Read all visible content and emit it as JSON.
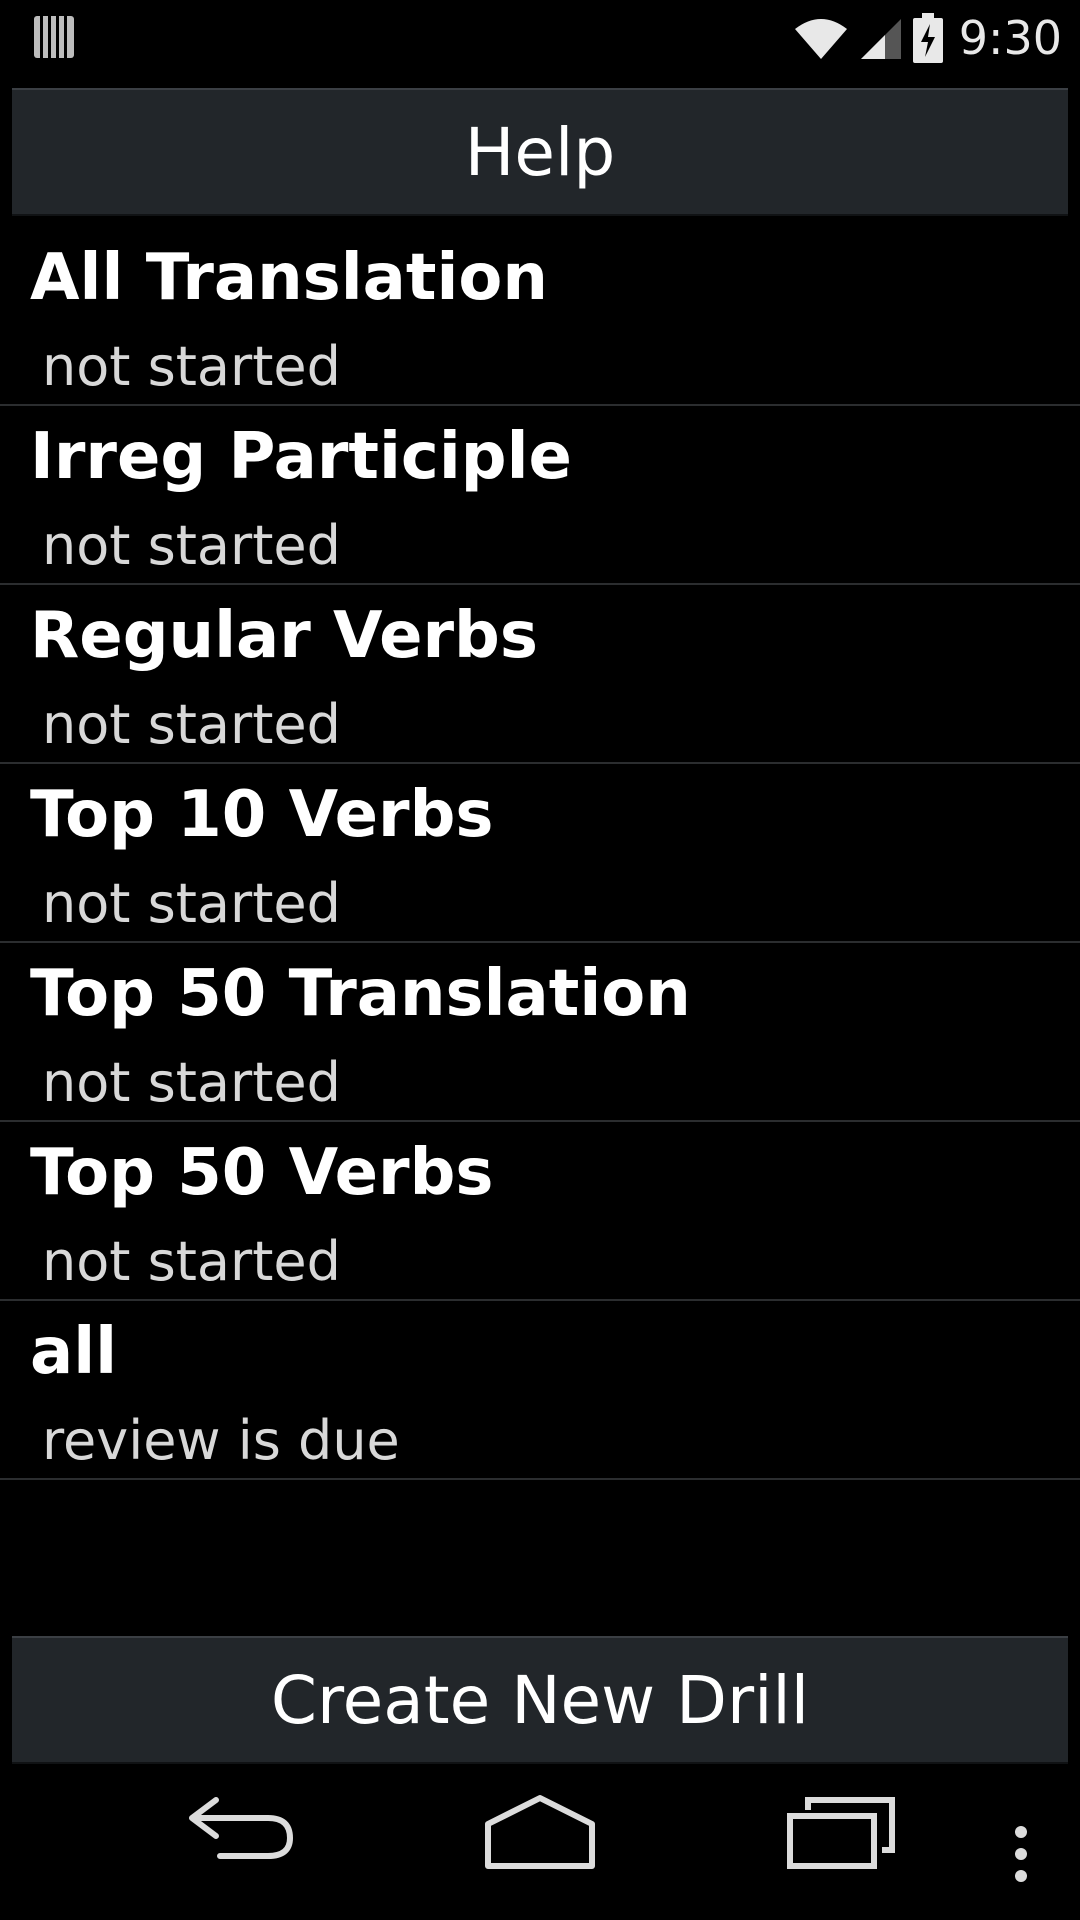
{
  "status_bar": {
    "time": "9:30",
    "icons": [
      "notification-bars-icon",
      "wifi-icon",
      "signal-icon",
      "battery-charging-icon"
    ]
  },
  "header_button": {
    "label": "Help"
  },
  "drills": [
    {
      "title": "All Translation",
      "status": "not started"
    },
    {
      "title": "Irreg Participle",
      "status": "not started"
    },
    {
      "title": "Regular Verbs",
      "status": "not started"
    },
    {
      "title": "Top 10 Verbs",
      "status": "not started"
    },
    {
      "title": "Top 50 Translation",
      "status": "not started"
    },
    {
      "title": "Top 50 Verbs",
      "status": "not started"
    },
    {
      "title": "all",
      "status": "review is due"
    }
  ],
  "footer_button": {
    "label": "Create New Drill"
  },
  "nav_bar": {
    "icons": [
      "back-icon",
      "home-icon",
      "recent-apps-icon",
      "overflow-menu-icon"
    ]
  },
  "colors": {
    "background": "#000000",
    "button_bg": "#22262a",
    "divider": "#2b2d2f",
    "secondary_text": "#d8d8d8"
  }
}
